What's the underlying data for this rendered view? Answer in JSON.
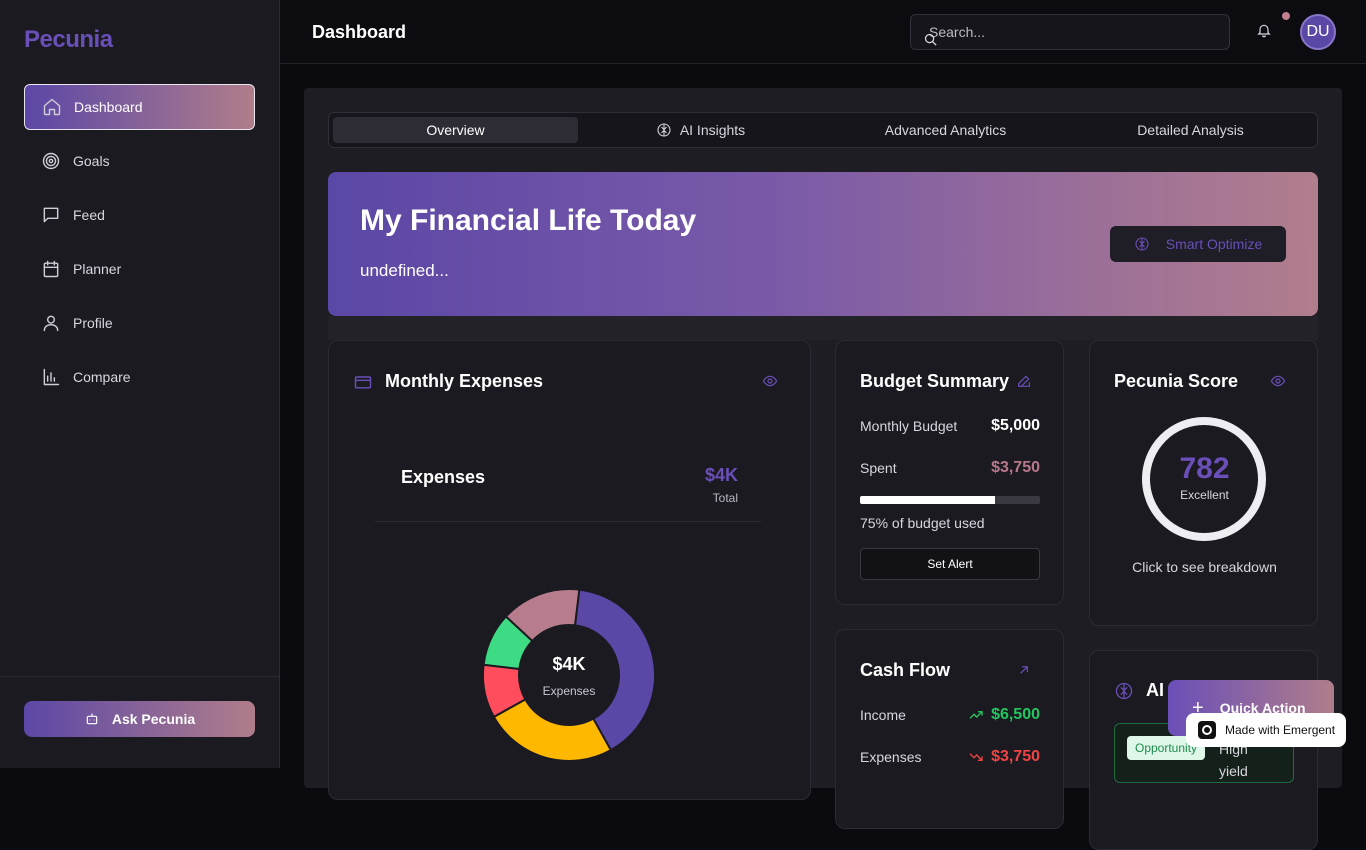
{
  "app": {
    "brand": "Pecunia",
    "page_title": "Dashboard"
  },
  "sidebar": {
    "items": [
      {
        "label": "Dashboard",
        "icon": "home-icon",
        "active": true
      },
      {
        "label": "Goals",
        "icon": "target-icon"
      },
      {
        "label": "Feed",
        "icon": "message-icon"
      },
      {
        "label": "Planner",
        "icon": "calendar-icon"
      },
      {
        "label": "Profile",
        "icon": "user-icon"
      },
      {
        "label": "Compare",
        "icon": "bar-chart-icon"
      }
    ],
    "ask_button": "Ask Pecunia"
  },
  "header": {
    "search_placeholder": "Search...",
    "avatar_initials": "DU",
    "has_notification": true
  },
  "tabs": [
    {
      "label": "Overview",
      "active": true
    },
    {
      "label": "AI Insights",
      "icon": "brain-icon"
    },
    {
      "label": "Advanced Analytics"
    },
    {
      "label": "Detailed Analysis"
    }
  ],
  "hero": {
    "title": "My Financial Life Today",
    "subtitle": "undefined...",
    "button": "Smart Optimize"
  },
  "expenses_card": {
    "title": "Monthly Expenses",
    "inner_title": "Expenses",
    "total_value": "$4K",
    "total_label": "Total",
    "donut_center_value": "$4K",
    "donut_center_label": "Expenses"
  },
  "chart_data": {
    "type": "pie",
    "values": [
      40,
      25,
      10,
      10,
      15
    ],
    "colors": [
      "#5b47a6",
      "#ffb800",
      "#ff4d5e",
      "#3ddc84",
      "#b87d8c"
    ]
  },
  "budget_card": {
    "title": "Budget Summary",
    "monthly_budget_label": "Monthly Budget",
    "monthly_budget_value": "$5,000",
    "spent_label": "Spent",
    "spent_value": "$3,750",
    "used_fraction": 0.75,
    "note": "75% of budget used",
    "alert_button": "Set Alert"
  },
  "score_card": {
    "title": "Pecunia Score",
    "value": "782",
    "rating": "Excellent",
    "hint": "Click to see breakdown"
  },
  "cashflow_card": {
    "title": "Cash Flow",
    "income_label": "Income",
    "income_value": "$6,500",
    "expenses_label": "Expenses",
    "expenses_value": "$3,750"
  },
  "ai_card": {
    "title": "AI I",
    "badge": "Opportunity",
    "text_line1": "High",
    "text_line2": "yield"
  },
  "quick_action": {
    "label": "Quick Action"
  },
  "emergent": {
    "label": "Made with Emergent"
  },
  "colors": {
    "accent": "#6a4fb8",
    "gradient_end": "#b07d8a",
    "positive": "#22c55e",
    "negative": "#ef4444",
    "spent": "#b8788c"
  }
}
